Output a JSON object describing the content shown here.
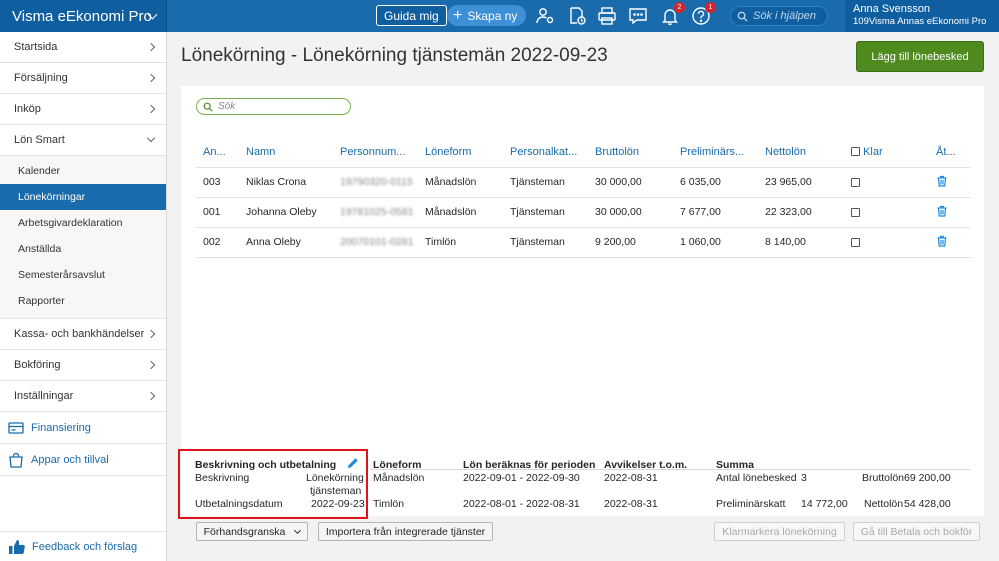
{
  "app": {
    "title": "Visma eEkonomi Pro"
  },
  "topbar": {
    "guide_label": "Guida mig",
    "create_label": "Skapa ny",
    "notifications_badge": "2",
    "help_badge": "1",
    "search_placeholder": "Sök i hjälpen",
    "user_name": "Anna Svensson",
    "user_company": "109Visma Annas eEkonomi Pro"
  },
  "sidebar": {
    "items": [
      {
        "label": "Startsida"
      },
      {
        "label": "Försäljning"
      },
      {
        "label": "Inköp"
      },
      {
        "label": "Lön Smart"
      }
    ],
    "sub_items": [
      {
        "label": "Kalender"
      },
      {
        "label": "Lönekörningar"
      },
      {
        "label": "Arbetsgivardeklaration"
      },
      {
        "label": "Anställda"
      },
      {
        "label": "Semesterårsavslut"
      },
      {
        "label": "Rapporter"
      }
    ],
    "items2": [
      {
        "label": "Kassa- och bankhändelser"
      },
      {
        "label": "Bokföring"
      },
      {
        "label": "Inställningar"
      }
    ],
    "finance_label": "Finansiering",
    "apps_label": "Appar och tillval",
    "feedback_label": "Feedback och förslag"
  },
  "main": {
    "title": "Lönekörning - Lönekörning tjänstemän 2022-09-23",
    "add_button": "Lägg till lönebesked",
    "search_placeholder": "Sök"
  },
  "table": {
    "headers": [
      "An...",
      "Namn",
      "Personnum...",
      "Löneform",
      "Personalkat...",
      "Bruttolön",
      "Preliminärs...",
      "Nettolön",
      "Klar",
      "Åt..."
    ],
    "rows": [
      {
        "nr": "003",
        "name": "Niklas Crona",
        "pnr": "19790320-0115",
        "form": "Månadslön",
        "cat": "Tjänsteman",
        "gross": "30 000,00",
        "tax": "6 035,00",
        "net": "23 965,00"
      },
      {
        "nr": "001",
        "name": "Johanna Oleby",
        "pnr": "19781025-0581",
        "form": "Månadslön",
        "cat": "Tjänsteman",
        "gross": "30 000,00",
        "tax": "7 677,00",
        "net": "22 323,00"
      },
      {
        "nr": "002",
        "name": "Anna Oleby",
        "pnr": "20070101-0281",
        "form": "Timlön",
        "cat": "Tjänsteman",
        "gross": "9 200,00",
        "tax": "1 060,00",
        "net": "8 140,00"
      }
    ]
  },
  "summary": {
    "desc_head": "Beskrivning och utbetalning",
    "desc_label": "Beskrivning",
    "desc_value_1": "Lönekörning",
    "desc_value_2": "tjänsteman",
    "pay_date_label": "Utbetalningsdatum",
    "pay_date_value": "2022-09-23",
    "form_head": "Löneform",
    "form_1": "Månadslön",
    "form_2": "Timlön",
    "period_head": "Lön beräknas för perioden",
    "period_1": "2022-09-01 - 2022-09-30",
    "period_2": "2022-08-01 - 2022-08-31",
    "dev_head": "Avvikelser t.o.m.",
    "dev_1": "2022-08-31",
    "dev_2": "2022-08-31",
    "sum_head": "Summa",
    "count_label": "Antal lönebesked",
    "count_value": "3",
    "gross_label": "Bruttolön",
    "gross_value": "69 200,00",
    "tax_label": "Preliminärskatt",
    "tax_value": "14 772,00",
    "net_label": "Nettolön",
    "net_value": "54 428,00"
  },
  "bottom": {
    "preview_label": "Förhandsgranska",
    "import_label": "Importera från integrerade tjänster",
    "mark_done_label": "Klarmarkera lönekörning",
    "pay_label": "Gå till Betala och bokför"
  }
}
